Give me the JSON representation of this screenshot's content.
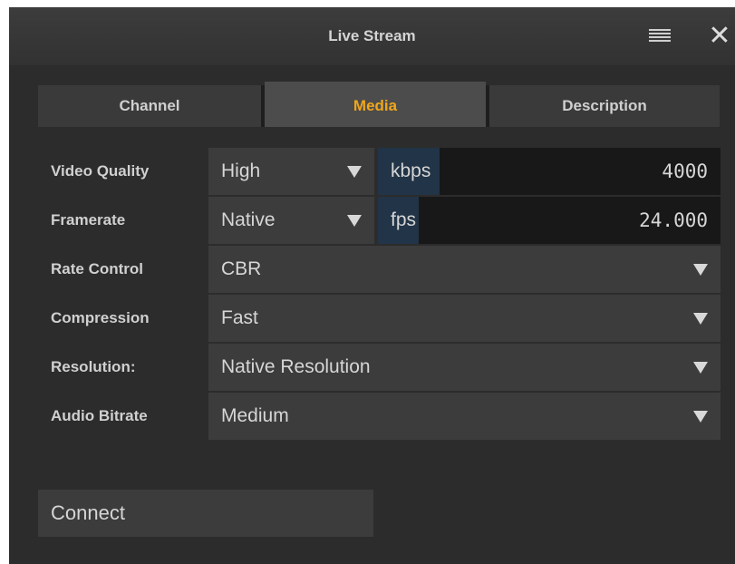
{
  "window": {
    "title": "Live Stream",
    "menu_icon": "hamburger-menu-icon",
    "close_glyph": "✕"
  },
  "tabs": [
    {
      "label": "Channel",
      "active": false
    },
    {
      "label": "Media",
      "active": true
    },
    {
      "label": "Description",
      "active": false
    }
  ],
  "settings": {
    "video_quality": {
      "label": "Video Quality",
      "value": "High",
      "unit": "kbps",
      "number": "4000",
      "fill_fraction": 0.18
    },
    "framerate": {
      "label": "Framerate",
      "value": "Native",
      "unit": "fps",
      "number": "24.000",
      "fill_fraction": 0.12
    },
    "rate_control": {
      "label": "Rate Control",
      "value": "CBR"
    },
    "compression": {
      "label": "Compression",
      "value": "Fast"
    },
    "resolution": {
      "label": "Resolution:",
      "value": "Native Resolution"
    },
    "audio_bitrate": {
      "label": "Audio Bitrate",
      "value": "Medium"
    }
  },
  "actions": {
    "connect_label": "Connect"
  },
  "colors": {
    "active_tab": "#f0a61a",
    "background": "#2c2c2c",
    "field_fill": "#223447"
  }
}
